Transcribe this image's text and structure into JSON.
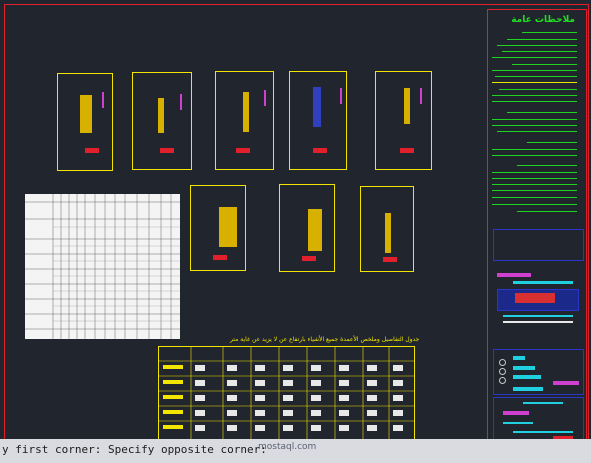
{
  "drawing": {
    "notes_title": "ملاحظات عامة",
    "schedule_title": "جدول التفاصيل وملخص الأعمدة جميع الأشياء بارتفاع عن لا يزيد عن غاية متر",
    "schedule_headers": [
      "الشكل",
      "الأول",
      "الثاني",
      "الثالث",
      "الرابع",
      "الخامس",
      "السادس",
      "السابع",
      "ملاحظات عامة"
    ]
  },
  "command_line": {
    "prompt": "y first corner: Specify opposite corner:"
  },
  "watermark": {
    "text": "mostaql.com"
  },
  "colors": {
    "background": "#21252d",
    "frame": "#e0202a",
    "geometry": "#f2e600",
    "text_notes": "#20e020",
    "accent_magenta": "#d040d0",
    "accent_cyan": "#20d0e0"
  }
}
